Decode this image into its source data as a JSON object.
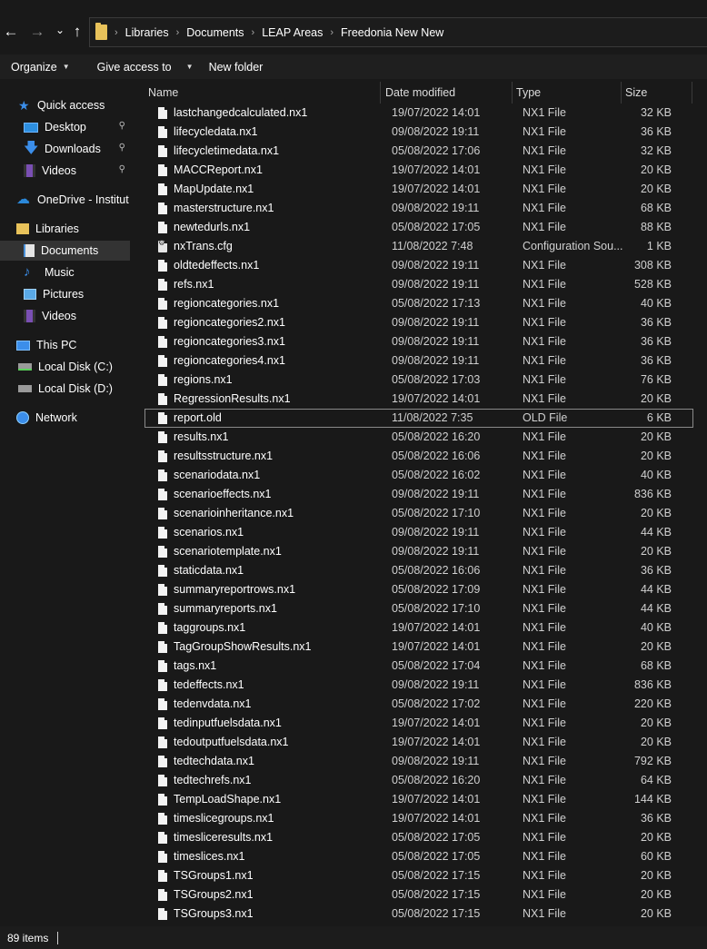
{
  "addressbar": {
    "back_icon": "←",
    "forward_icon": "→",
    "recent_icon": "⌄",
    "up_icon": "↑",
    "breadcrumbs": [
      "Libraries",
      "Documents",
      "LEAP Areas",
      "Freedonia New New"
    ]
  },
  "toolbar": {
    "organize": "Organize",
    "give_access": "Give access to",
    "new_folder": "New folder"
  },
  "sidebar": {
    "quick_access": "Quick access",
    "desktop": "Desktop",
    "downloads": "Downloads",
    "videos_qa": "Videos",
    "onedrive": "OneDrive - Institut",
    "libraries": "Libraries",
    "documents": "Documents",
    "music": "Music",
    "pictures": "Pictures",
    "videos": "Videos",
    "this_pc": "This PC",
    "disk_c": "Local Disk (C:)",
    "disk_d": "Local Disk (D:)",
    "network": "Network",
    "pin_icon": "📌"
  },
  "columns": {
    "name": "Name",
    "date": "Date modified",
    "type": "Type",
    "size": "Size"
  },
  "files": [
    {
      "name": "lastchangedcalculated.nx1",
      "date": "19/07/2022 14:01",
      "type": "NX1 File",
      "size": "32 KB"
    },
    {
      "name": "lifecycledata.nx1",
      "date": "09/08/2022 19:11",
      "type": "NX1 File",
      "size": "36 KB"
    },
    {
      "name": "lifecycletimedata.nx1",
      "date": "05/08/2022 17:06",
      "type": "NX1 File",
      "size": "32 KB"
    },
    {
      "name": "MACCReport.nx1",
      "date": "19/07/2022 14:01",
      "type": "NX1 File",
      "size": "20 KB"
    },
    {
      "name": "MapUpdate.nx1",
      "date": "19/07/2022 14:01",
      "type": "NX1 File",
      "size": "20 KB"
    },
    {
      "name": "masterstructure.nx1",
      "date": "09/08/2022 19:11",
      "type": "NX1 File",
      "size": "68 KB"
    },
    {
      "name": "newtedurls.nx1",
      "date": "05/08/2022 17:05",
      "type": "NX1 File",
      "size": "88 KB"
    },
    {
      "name": "nxTrans.cfg",
      "date": "11/08/2022 7:48",
      "type": "Configuration Sou...",
      "size": "1 KB"
    },
    {
      "name": "oldtedeffects.nx1",
      "date": "09/08/2022 19:11",
      "type": "NX1 File",
      "size": "308 KB"
    },
    {
      "name": "refs.nx1",
      "date": "09/08/2022 19:11",
      "type": "NX1 File",
      "size": "528 KB"
    },
    {
      "name": "regioncategories.nx1",
      "date": "05/08/2022 17:13",
      "type": "NX1 File",
      "size": "40 KB"
    },
    {
      "name": "regioncategories2.nx1",
      "date": "09/08/2022 19:11",
      "type": "NX1 File",
      "size": "36 KB"
    },
    {
      "name": "regioncategories3.nx1",
      "date": "09/08/2022 19:11",
      "type": "NX1 File",
      "size": "36 KB"
    },
    {
      "name": "regioncategories4.nx1",
      "date": "09/08/2022 19:11",
      "type": "NX1 File",
      "size": "36 KB"
    },
    {
      "name": "regions.nx1",
      "date": "05/08/2022 17:03",
      "type": "NX1 File",
      "size": "76 KB"
    },
    {
      "name": "RegressionResults.nx1",
      "date": "19/07/2022 14:01",
      "type": "NX1 File",
      "size": "20 KB"
    },
    {
      "name": "report.old",
      "date": "11/08/2022 7:35",
      "type": "OLD File",
      "size": "6 KB"
    },
    {
      "name": "results.nx1",
      "date": "05/08/2022 16:20",
      "type": "NX1 File",
      "size": "20 KB"
    },
    {
      "name": "resultsstructure.nx1",
      "date": "05/08/2022 16:06",
      "type": "NX1 File",
      "size": "20 KB"
    },
    {
      "name": "scenariodata.nx1",
      "date": "05/08/2022 16:02",
      "type": "NX1 File",
      "size": "40 KB"
    },
    {
      "name": "scenarioeffects.nx1",
      "date": "09/08/2022 19:11",
      "type": "NX1 File",
      "size": "836 KB"
    },
    {
      "name": "scenarioinheritance.nx1",
      "date": "05/08/2022 17:10",
      "type": "NX1 File",
      "size": "20 KB"
    },
    {
      "name": "scenarios.nx1",
      "date": "09/08/2022 19:11",
      "type": "NX1 File",
      "size": "44 KB"
    },
    {
      "name": "scenariotemplate.nx1",
      "date": "09/08/2022 19:11",
      "type": "NX1 File",
      "size": "20 KB"
    },
    {
      "name": "staticdata.nx1",
      "date": "05/08/2022 16:06",
      "type": "NX1 File",
      "size": "36 KB"
    },
    {
      "name": "summaryreportrows.nx1",
      "date": "05/08/2022 17:09",
      "type": "NX1 File",
      "size": "44 KB"
    },
    {
      "name": "summaryreports.nx1",
      "date": "05/08/2022 17:10",
      "type": "NX1 File",
      "size": "44 KB"
    },
    {
      "name": "taggroups.nx1",
      "date": "19/07/2022 14:01",
      "type": "NX1 File",
      "size": "40 KB"
    },
    {
      "name": "TagGroupShowResults.nx1",
      "date": "19/07/2022 14:01",
      "type": "NX1 File",
      "size": "20 KB"
    },
    {
      "name": "tags.nx1",
      "date": "05/08/2022 17:04",
      "type": "NX1 File",
      "size": "68 KB"
    },
    {
      "name": "tedeffects.nx1",
      "date": "09/08/2022 19:11",
      "type": "NX1 File",
      "size": "836 KB"
    },
    {
      "name": "tedenvdata.nx1",
      "date": "05/08/2022 17:02",
      "type": "NX1 File",
      "size": "220 KB"
    },
    {
      "name": "tedinputfuelsdata.nx1",
      "date": "19/07/2022 14:01",
      "type": "NX1 File",
      "size": "20 KB"
    },
    {
      "name": "tedoutputfuelsdata.nx1",
      "date": "19/07/2022 14:01",
      "type": "NX1 File",
      "size": "20 KB"
    },
    {
      "name": "tedtechdata.nx1",
      "date": "09/08/2022 19:11",
      "type": "NX1 File",
      "size": "792 KB"
    },
    {
      "name": "tedtechrefs.nx1",
      "date": "05/08/2022 16:20",
      "type": "NX1 File",
      "size": "64 KB"
    },
    {
      "name": "TempLoadShape.nx1",
      "date": "19/07/2022 14:01",
      "type": "NX1 File",
      "size": "144 KB"
    },
    {
      "name": "timeslicegroups.nx1",
      "date": "19/07/2022 14:01",
      "type": "NX1 File",
      "size": "36 KB"
    },
    {
      "name": "timesliceresults.nx1",
      "date": "05/08/2022 17:05",
      "type": "NX1 File",
      "size": "20 KB"
    },
    {
      "name": "timeslices.nx1",
      "date": "05/08/2022 17:05",
      "type": "NX1 File",
      "size": "60 KB"
    },
    {
      "name": "TSGroups1.nx1",
      "date": "05/08/2022 17:15",
      "type": "NX1 File",
      "size": "20 KB"
    },
    {
      "name": "TSGroups2.nx1",
      "date": "05/08/2022 17:15",
      "type": "NX1 File",
      "size": "20 KB"
    },
    {
      "name": "TSGroups3.nx1",
      "date": "05/08/2022 17:15",
      "type": "NX1 File",
      "size": "20 KB"
    }
  ],
  "status": {
    "item_count": "89 items"
  }
}
